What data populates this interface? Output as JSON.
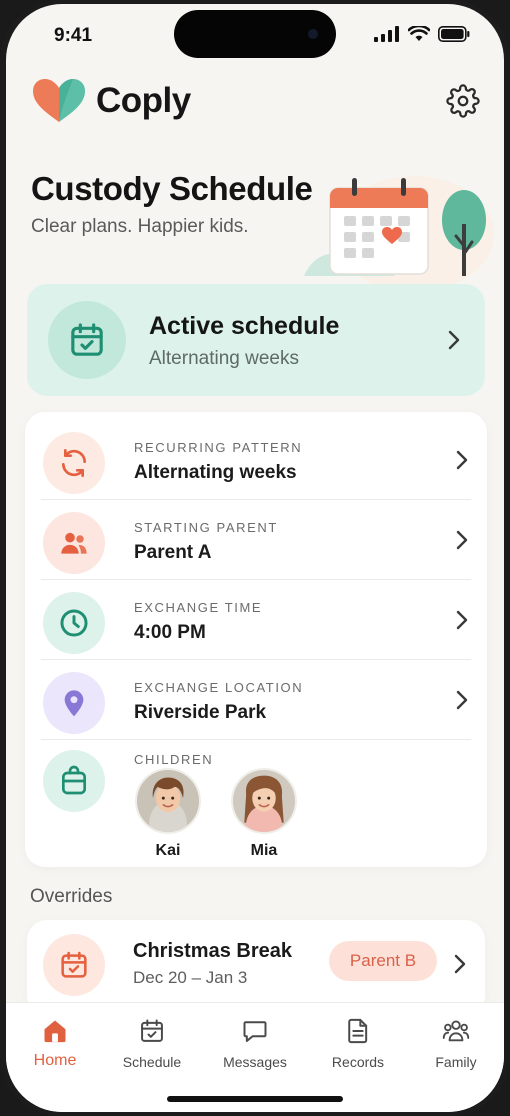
{
  "status_bar": {
    "time": "9:41"
  },
  "brand": {
    "name": "Coply"
  },
  "hero": {
    "title": "Custody Schedule",
    "subtitle": "Clear plans. Happier kids."
  },
  "active_schedule": {
    "title": "Active schedule",
    "subtitle": "Alternating weeks"
  },
  "settings_list": [
    {
      "label": "RECURRING PATTERN",
      "value": "Alternating weeks",
      "icon": "repeat-icon"
    },
    {
      "label": "STARTING PARENT",
      "value": "Parent A",
      "icon": "users-icon"
    },
    {
      "label": "EXCHANGE TIME",
      "value": "4:00 PM",
      "icon": "clock-icon"
    },
    {
      "label": "EXCHANGE LOCATION",
      "value": "Riverside Park",
      "icon": "location-pin-icon"
    }
  ],
  "children": {
    "label": "CHILDREN",
    "kids": [
      {
        "name": "Kai"
      },
      {
        "name": "Mia"
      }
    ]
  },
  "overrides": {
    "title": "Overrides",
    "items": [
      {
        "title": "Christmas Break",
        "dates": "Dec 20 – Jan 3",
        "badge": "Parent B"
      }
    ]
  },
  "tab_bar": {
    "tabs": [
      {
        "label": "Home",
        "icon": "home-icon",
        "active": true
      },
      {
        "label": "Schedule",
        "icon": "calendar-check-icon"
      },
      {
        "label": "Messages",
        "icon": "message-icon"
      },
      {
        "label": "Records",
        "icon": "document-icon"
      },
      {
        "label": "Family",
        "icon": "family-icon"
      }
    ]
  },
  "colors": {
    "accent": "#e0613f",
    "teal": "#2f9c83",
    "mint_card": "#dcf2ea",
    "background": "#f7f5f1"
  }
}
